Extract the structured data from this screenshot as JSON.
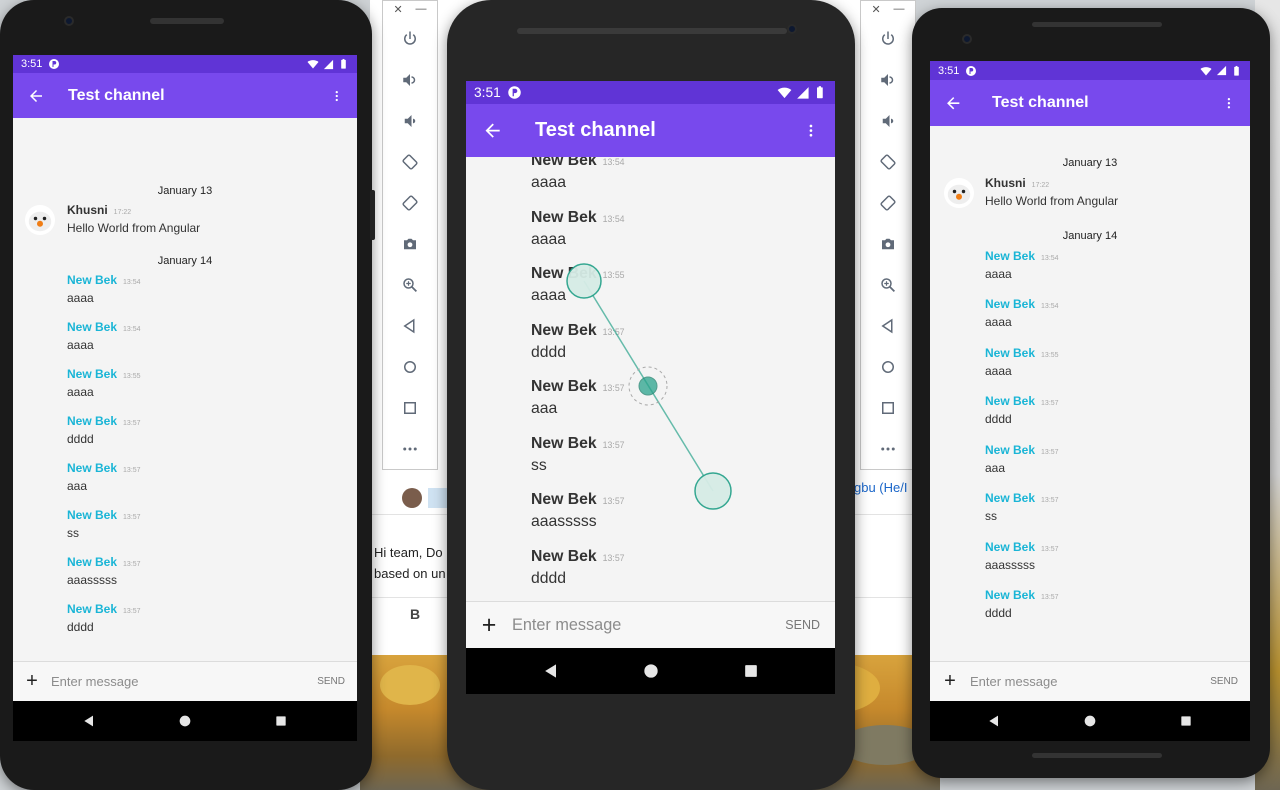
{
  "channel_title": "Test channel",
  "status_time": "3:51",
  "composer": {
    "placeholder": "Enter message",
    "send_label": "SEND",
    "add_symbol": "+"
  },
  "messages": [
    {
      "date": "January 13"
    },
    {
      "name": "Khusni",
      "time": "17:22",
      "text": "Hello World from Angular",
      "own": false
    },
    {
      "date": "January 14"
    },
    {
      "name": "New Bek",
      "time": "13:54",
      "text": "aaaa"
    },
    {
      "name": "New Bek",
      "time": "13:54",
      "text": "aaaa"
    },
    {
      "name": "New Bek",
      "time": "13:55",
      "text": "aaaa"
    },
    {
      "name": "New Bek",
      "time": "13:57",
      "text": "dddd"
    },
    {
      "name": "New Bek",
      "time": "13:57",
      "text": "aaa"
    },
    {
      "name": "New Bek",
      "time": "13:57",
      "text": "ss"
    },
    {
      "name": "New Bek",
      "time": "13:57",
      "text": "aaasssss"
    },
    {
      "name": "New Bek",
      "time": "13:57",
      "text": "dddd"
    }
  ],
  "background_window": {
    "snippets": [
      "Hi team, Do",
      "based on un",
      "gbu (He/I"
    ],
    "toolbar_bold": "B"
  },
  "emulator_tools": [
    "power-icon",
    "volume-up-icon",
    "volume-down-icon",
    "rotate-left-icon",
    "rotate-right-icon",
    "camera-icon",
    "zoom-icon",
    "back-icon",
    "home-icon",
    "overview-icon",
    "more-icon"
  ],
  "colors": {
    "status_bar": "#6034d6",
    "app_bar": "#7849ed",
    "sender_name": "#1ab5d6",
    "timestamp": "#a9a9a9",
    "touch_marker": "#2aa38c"
  }
}
